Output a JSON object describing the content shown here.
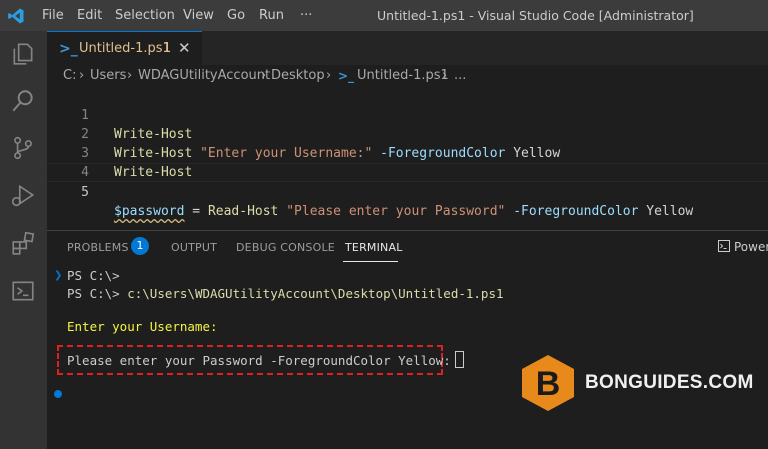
{
  "window": {
    "title": "Untitled-1.ps1 - Visual Studio Code [Administrator]",
    "menu": [
      "File",
      "Edit",
      "Selection",
      "View",
      "Go",
      "Run",
      "···"
    ]
  },
  "activity_bar": [
    "explorer-icon",
    "search-icon",
    "source-control-icon",
    "run-debug-icon",
    "extensions-icon",
    "terminal-icon"
  ],
  "tab": {
    "label": "Untitled-1.ps1",
    "problem_count": "1",
    "close_glyph": "✕",
    "icon_glyph": ">_"
  },
  "breadcrumb": [
    "C:",
    "Users",
    "WDAGUtilityAccount",
    "Desktop",
    "Untitled-1.ps1",
    "..."
  ],
  "editor": {
    "lines": [
      {
        "num": "1",
        "cmd": "Write-Host"
      },
      {
        "num": "2",
        "cmd": "Write-Host",
        "str": "\"Enter your Username:\"",
        "param": "-ForegroundColor",
        "value": "Yellow"
      },
      {
        "num": "3",
        "cmd": "Write-Host"
      },
      {
        "num": "4"
      },
      {
        "num": "5",
        "var": "$password",
        "op": "=",
        "cmd": "Read-Host",
        "str": "\"Please enter your Password\"",
        "param": "-ForegroundColor",
        "value": "Yellow"
      }
    ]
  },
  "panel": {
    "tabs": [
      "PROBLEMS",
      "OUTPUT",
      "DEBUG CONSOLE",
      "TERMINAL"
    ],
    "problems_badge": "1",
    "shell_label": "Power"
  },
  "terminal": {
    "line1": "PS C:\\>",
    "line2_prompt": "PS C:\\>",
    "line2_cmd": "c:\\Users\\WDAGUtilityAccount\\Desktop\\Untitled-1.ps1",
    "line3": "Enter your Username:",
    "line4": "Please enter your Password -ForegroundColor Yellow:"
  },
  "watermark": {
    "letter": "B",
    "text": "BONGUIDES.COM"
  },
  "colors": {
    "accent": "#0078d4",
    "terminal_yellow": "#f5f543",
    "highlight_box": "#e02020",
    "logo": "#e8891c"
  }
}
